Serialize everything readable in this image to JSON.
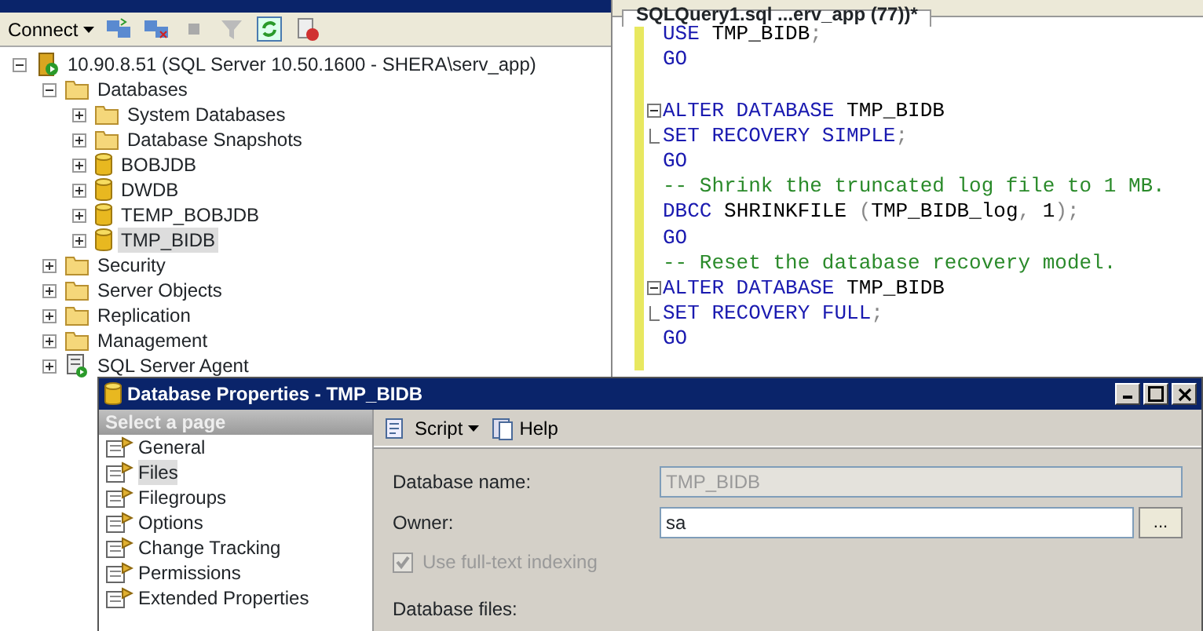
{
  "explorer": {
    "toolbar": {
      "connect": "Connect"
    },
    "tree": [
      {
        "label": "10.90.8.51 (SQL Server 10.50.1600 - SHERA\\serv_app)",
        "kind": "server",
        "expanded": true,
        "selected": false,
        "children": [
          {
            "label": "Databases",
            "kind": "folder",
            "expanded": true,
            "selected": false,
            "children": [
              {
                "label": "System Databases",
                "kind": "folder",
                "expanded": false,
                "selected": false
              },
              {
                "label": "Database Snapshots",
                "kind": "folder",
                "expanded": false,
                "selected": false
              },
              {
                "label": "BOBJDB",
                "kind": "database",
                "expanded": false,
                "selected": false
              },
              {
                "label": "DWDB",
                "kind": "database",
                "expanded": false,
                "selected": false
              },
              {
                "label": "TEMP_BOBJDB",
                "kind": "database",
                "expanded": false,
                "selected": false
              },
              {
                "label": "TMP_BIDB",
                "kind": "database",
                "expanded": false,
                "selected": true
              }
            ]
          },
          {
            "label": "Security",
            "kind": "folder",
            "expanded": false,
            "selected": false
          },
          {
            "label": "Server Objects",
            "kind": "folder",
            "expanded": false,
            "selected": false
          },
          {
            "label": "Replication",
            "kind": "folder",
            "expanded": false,
            "selected": false
          },
          {
            "label": "Management",
            "kind": "folder",
            "expanded": false,
            "selected": false
          },
          {
            "label": "SQL Server Agent",
            "kind": "agent",
            "expanded": false,
            "selected": false
          }
        ]
      }
    ]
  },
  "editor": {
    "tab": "SQLQuery1.sql ...erv_app (77))*",
    "lines": [
      {
        "kind": "code",
        "tokens": [
          {
            "kind": "keyword",
            "text": "USE"
          },
          {
            "kind": "plain",
            "text": " TMP_BIDB"
          },
          {
            "kind": "punct",
            "text": ";"
          }
        ]
      },
      {
        "kind": "code",
        "tokens": [
          {
            "kind": "keyword",
            "text": "GO"
          }
        ]
      },
      {
        "kind": "blank"
      },
      {
        "kind": "fold_start",
        "tokens": [
          {
            "kind": "keyword",
            "text": "ALTER DATABASE"
          },
          {
            "kind": "plain",
            "text": " TMP_BIDB"
          }
        ]
      },
      {
        "kind": "fold_end",
        "tokens": [
          {
            "kind": "keyword",
            "text": "SET RECOVERY SIMPLE"
          },
          {
            "kind": "punct",
            "text": ";"
          }
        ]
      },
      {
        "kind": "code",
        "tokens": [
          {
            "kind": "keyword",
            "text": "GO"
          }
        ]
      },
      {
        "kind": "code",
        "tokens": [
          {
            "kind": "comment",
            "text": "-- Shrink the truncated log file to 1 MB."
          }
        ]
      },
      {
        "kind": "code",
        "tokens": [
          {
            "kind": "keyword",
            "text": "DBCC"
          },
          {
            "kind": "plain",
            "text": " SHRINKFILE "
          },
          {
            "kind": "punct",
            "text": "("
          },
          {
            "kind": "plain",
            "text": "TMP_BIDB_log"
          },
          {
            "kind": "punct",
            "text": ", "
          },
          {
            "kind": "plain",
            "text": "1"
          },
          {
            "kind": "punct",
            "text": ");"
          }
        ]
      },
      {
        "kind": "code",
        "tokens": [
          {
            "kind": "keyword",
            "text": "GO"
          }
        ]
      },
      {
        "kind": "code",
        "tokens": [
          {
            "kind": "comment",
            "text": "-- Reset the database recovery model."
          }
        ]
      },
      {
        "kind": "fold_start",
        "tokens": [
          {
            "kind": "keyword",
            "text": "ALTER DATABASE"
          },
          {
            "kind": "plain",
            "text": " TMP_BIDB"
          }
        ]
      },
      {
        "kind": "fold_end",
        "tokens": [
          {
            "kind": "keyword",
            "text": "SET RECOVERY FULL"
          },
          {
            "kind": "punct",
            "text": ";"
          }
        ]
      },
      {
        "kind": "code",
        "tokens": [
          {
            "kind": "keyword",
            "text": "GO"
          }
        ]
      }
    ]
  },
  "dialog": {
    "title": "Database Properties - TMP_BIDB",
    "pages_header": "Select a page",
    "pages": [
      {
        "label": "General",
        "selected": false
      },
      {
        "label": "Files",
        "selected": true
      },
      {
        "label": "Filegroups",
        "selected": false
      },
      {
        "label": "Options",
        "selected": false
      },
      {
        "label": "Change Tracking",
        "selected": false
      },
      {
        "label": "Permissions",
        "selected": false
      },
      {
        "label": "Extended Properties",
        "selected": false
      }
    ],
    "toolbar": {
      "script": "Script",
      "help": "Help"
    },
    "database_name": {
      "label": "Database name:",
      "value": "TMP_BIDB",
      "disabled": true
    },
    "owner": {
      "label": "Owner:",
      "value": "sa",
      "browse": "..."
    },
    "fulltext": {
      "label": "Use full-text indexing",
      "checked": true,
      "disabled": true
    },
    "files_label": "Database files:"
  }
}
